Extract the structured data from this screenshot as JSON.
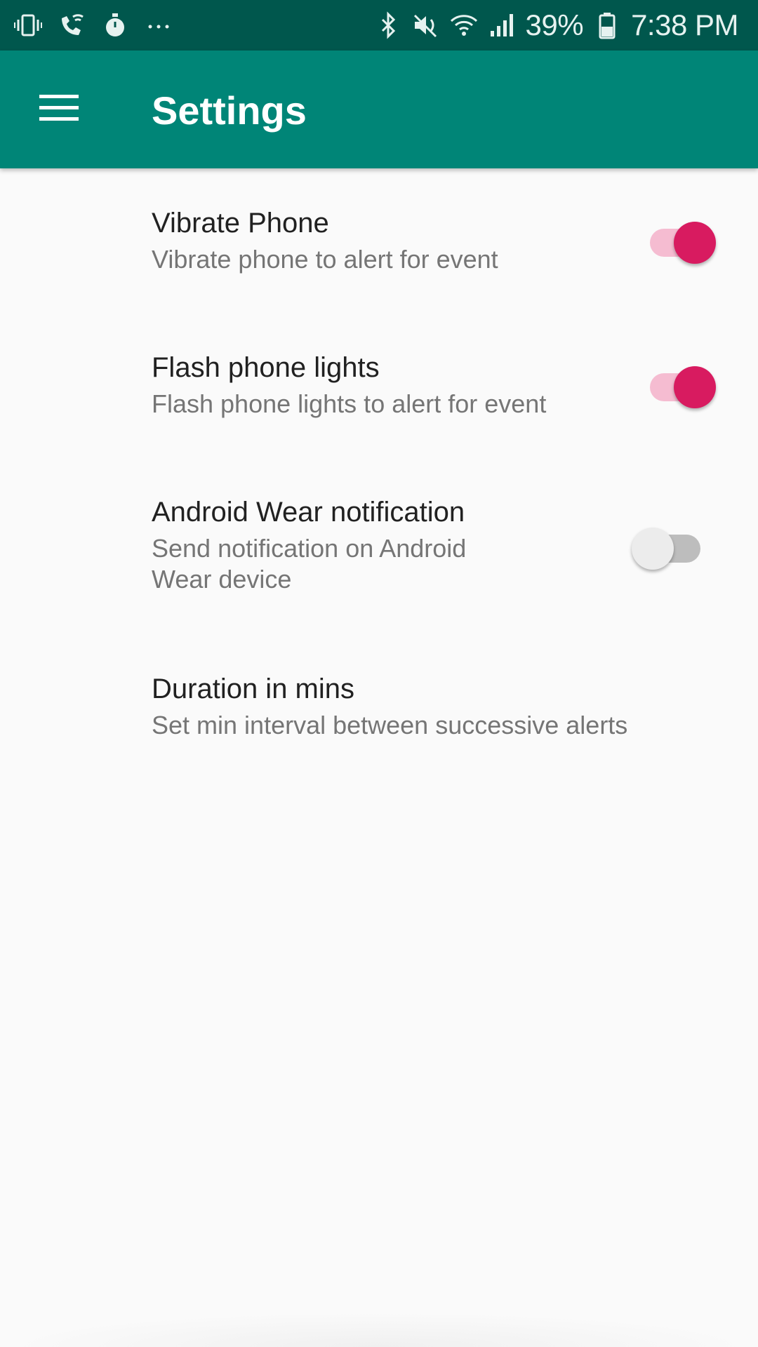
{
  "status_bar": {
    "left_icons": [
      "vibrate-icon",
      "wifi-calling-icon",
      "stopwatch-icon",
      "more-notifications-icon"
    ],
    "right_icons": [
      "bluetooth-icon",
      "mute-icon",
      "wifi-icon",
      "signal-icon",
      "battery-icon"
    ],
    "battery_percent": "39%",
    "time": "7:38 PM"
  },
  "app_bar": {
    "menu_icon": "menu-icon",
    "title": "Settings",
    "background_color": "#008577"
  },
  "preferences": [
    {
      "title": "Vibrate Phone",
      "summary": "Vibrate phone to alert for event",
      "switch_on": true
    },
    {
      "title": "Flash phone lights",
      "summary": "Flash phone lights to alert for event",
      "switch_on": true
    },
    {
      "title": "Android Wear notification",
      "summary_line1": "Send notification on Android",
      "summary_line2": "Wear device",
      "switch_on": false
    },
    {
      "title": "Duration in mins",
      "summary": "Set min interval between successive alerts"
    }
  ],
  "colors": {
    "accent": "#d81b60",
    "primary_dark": "#00574d"
  }
}
